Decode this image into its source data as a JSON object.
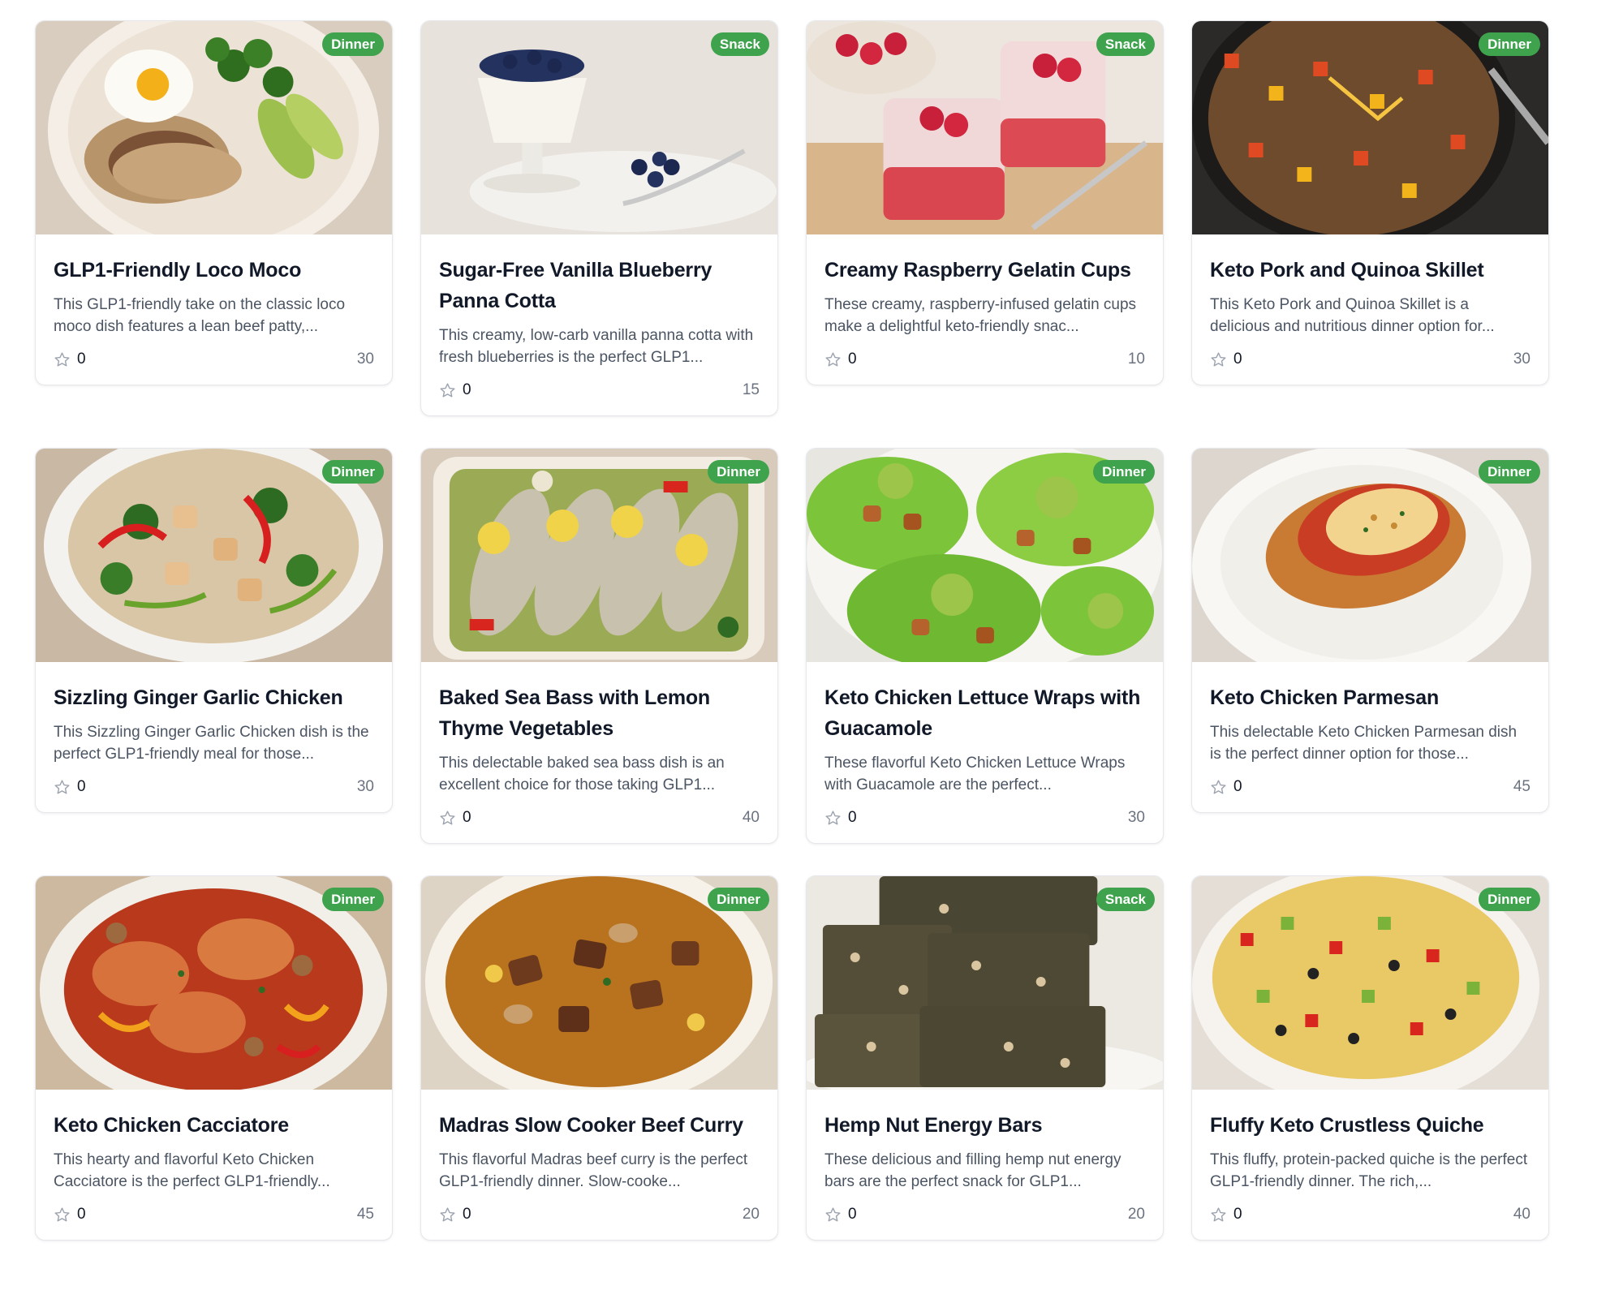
{
  "recipes": [
    {
      "title": "GLP1-Friendly Loco Moco",
      "description": "This GLP1-friendly take on the classic loco moco dish features a lean beef patty,...",
      "tag": "Dinner",
      "rating": "0",
      "time": "30"
    },
    {
      "title": "Sugar-Free Vanilla Blueberry Panna Cotta",
      "description": "This creamy, low-carb vanilla panna cotta with fresh blueberries is the perfect GLP1...",
      "tag": "Snack",
      "rating": "0",
      "time": "15"
    },
    {
      "title": "Creamy Raspberry Gelatin Cups",
      "description": "These creamy, raspberry-infused gelatin cups make a delightful keto-friendly snac...",
      "tag": "Snack",
      "rating": "0",
      "time": "10"
    },
    {
      "title": "Keto Pork and Quinoa Skillet",
      "description": "This Keto Pork and Quinoa Skillet is a delicious and nutritious dinner option for...",
      "tag": "Dinner",
      "rating": "0",
      "time": "30"
    },
    {
      "title": "Sizzling Ginger Garlic Chicken",
      "description": "This Sizzling Ginger Garlic Chicken dish is the perfect GLP1-friendly meal for those...",
      "tag": "Dinner",
      "rating": "0",
      "time": "30"
    },
    {
      "title": "Baked Sea Bass with Lemon Thyme Vegetables",
      "description": "This delectable baked sea bass dish is an excellent choice for those taking GLP1...",
      "tag": "Dinner",
      "rating": "0",
      "time": "40"
    },
    {
      "title": "Keto Chicken Lettuce Wraps with Guacamole",
      "description": "These flavorful Keto Chicken Lettuce Wraps with Guacamole are the perfect...",
      "tag": "Dinner",
      "rating": "0",
      "time": "30"
    },
    {
      "title": "Keto Chicken Parmesan",
      "description": "This delectable Keto Chicken Parmesan dish is the perfect dinner option for those...",
      "tag": "Dinner",
      "rating": "0",
      "time": "45"
    },
    {
      "title": "Keto Chicken Cacciatore",
      "description": "This hearty and flavorful Keto Chicken Cacciatore is the perfect GLP1-friendly...",
      "tag": "Dinner",
      "rating": "0",
      "time": "45"
    },
    {
      "title": "Madras Slow Cooker Beef Curry",
      "description": "This flavorful Madras beef curry is the perfect GLP1-friendly dinner. Slow-cooke...",
      "tag": "Dinner",
      "rating": "0",
      "time": "20"
    },
    {
      "title": "Hemp Nut Energy Bars",
      "description": "These delicious and filling hemp nut energy bars are the perfect snack for GLP1...",
      "tag": "Snack",
      "rating": "0",
      "time": "20"
    },
    {
      "title": "Fluffy Keto Crustless Quiche",
      "description": "This fluffy, protein-packed quiche is the perfect GLP1-friendly dinner. The rich,...",
      "tag": "Dinner",
      "rating": "0",
      "time": "40"
    }
  ],
  "icons": {
    "rating": "star-outline-icon"
  },
  "colors": {
    "badge": "#3fa34d",
    "card_border": "#e5e7eb",
    "text_muted": "#4b5563"
  }
}
